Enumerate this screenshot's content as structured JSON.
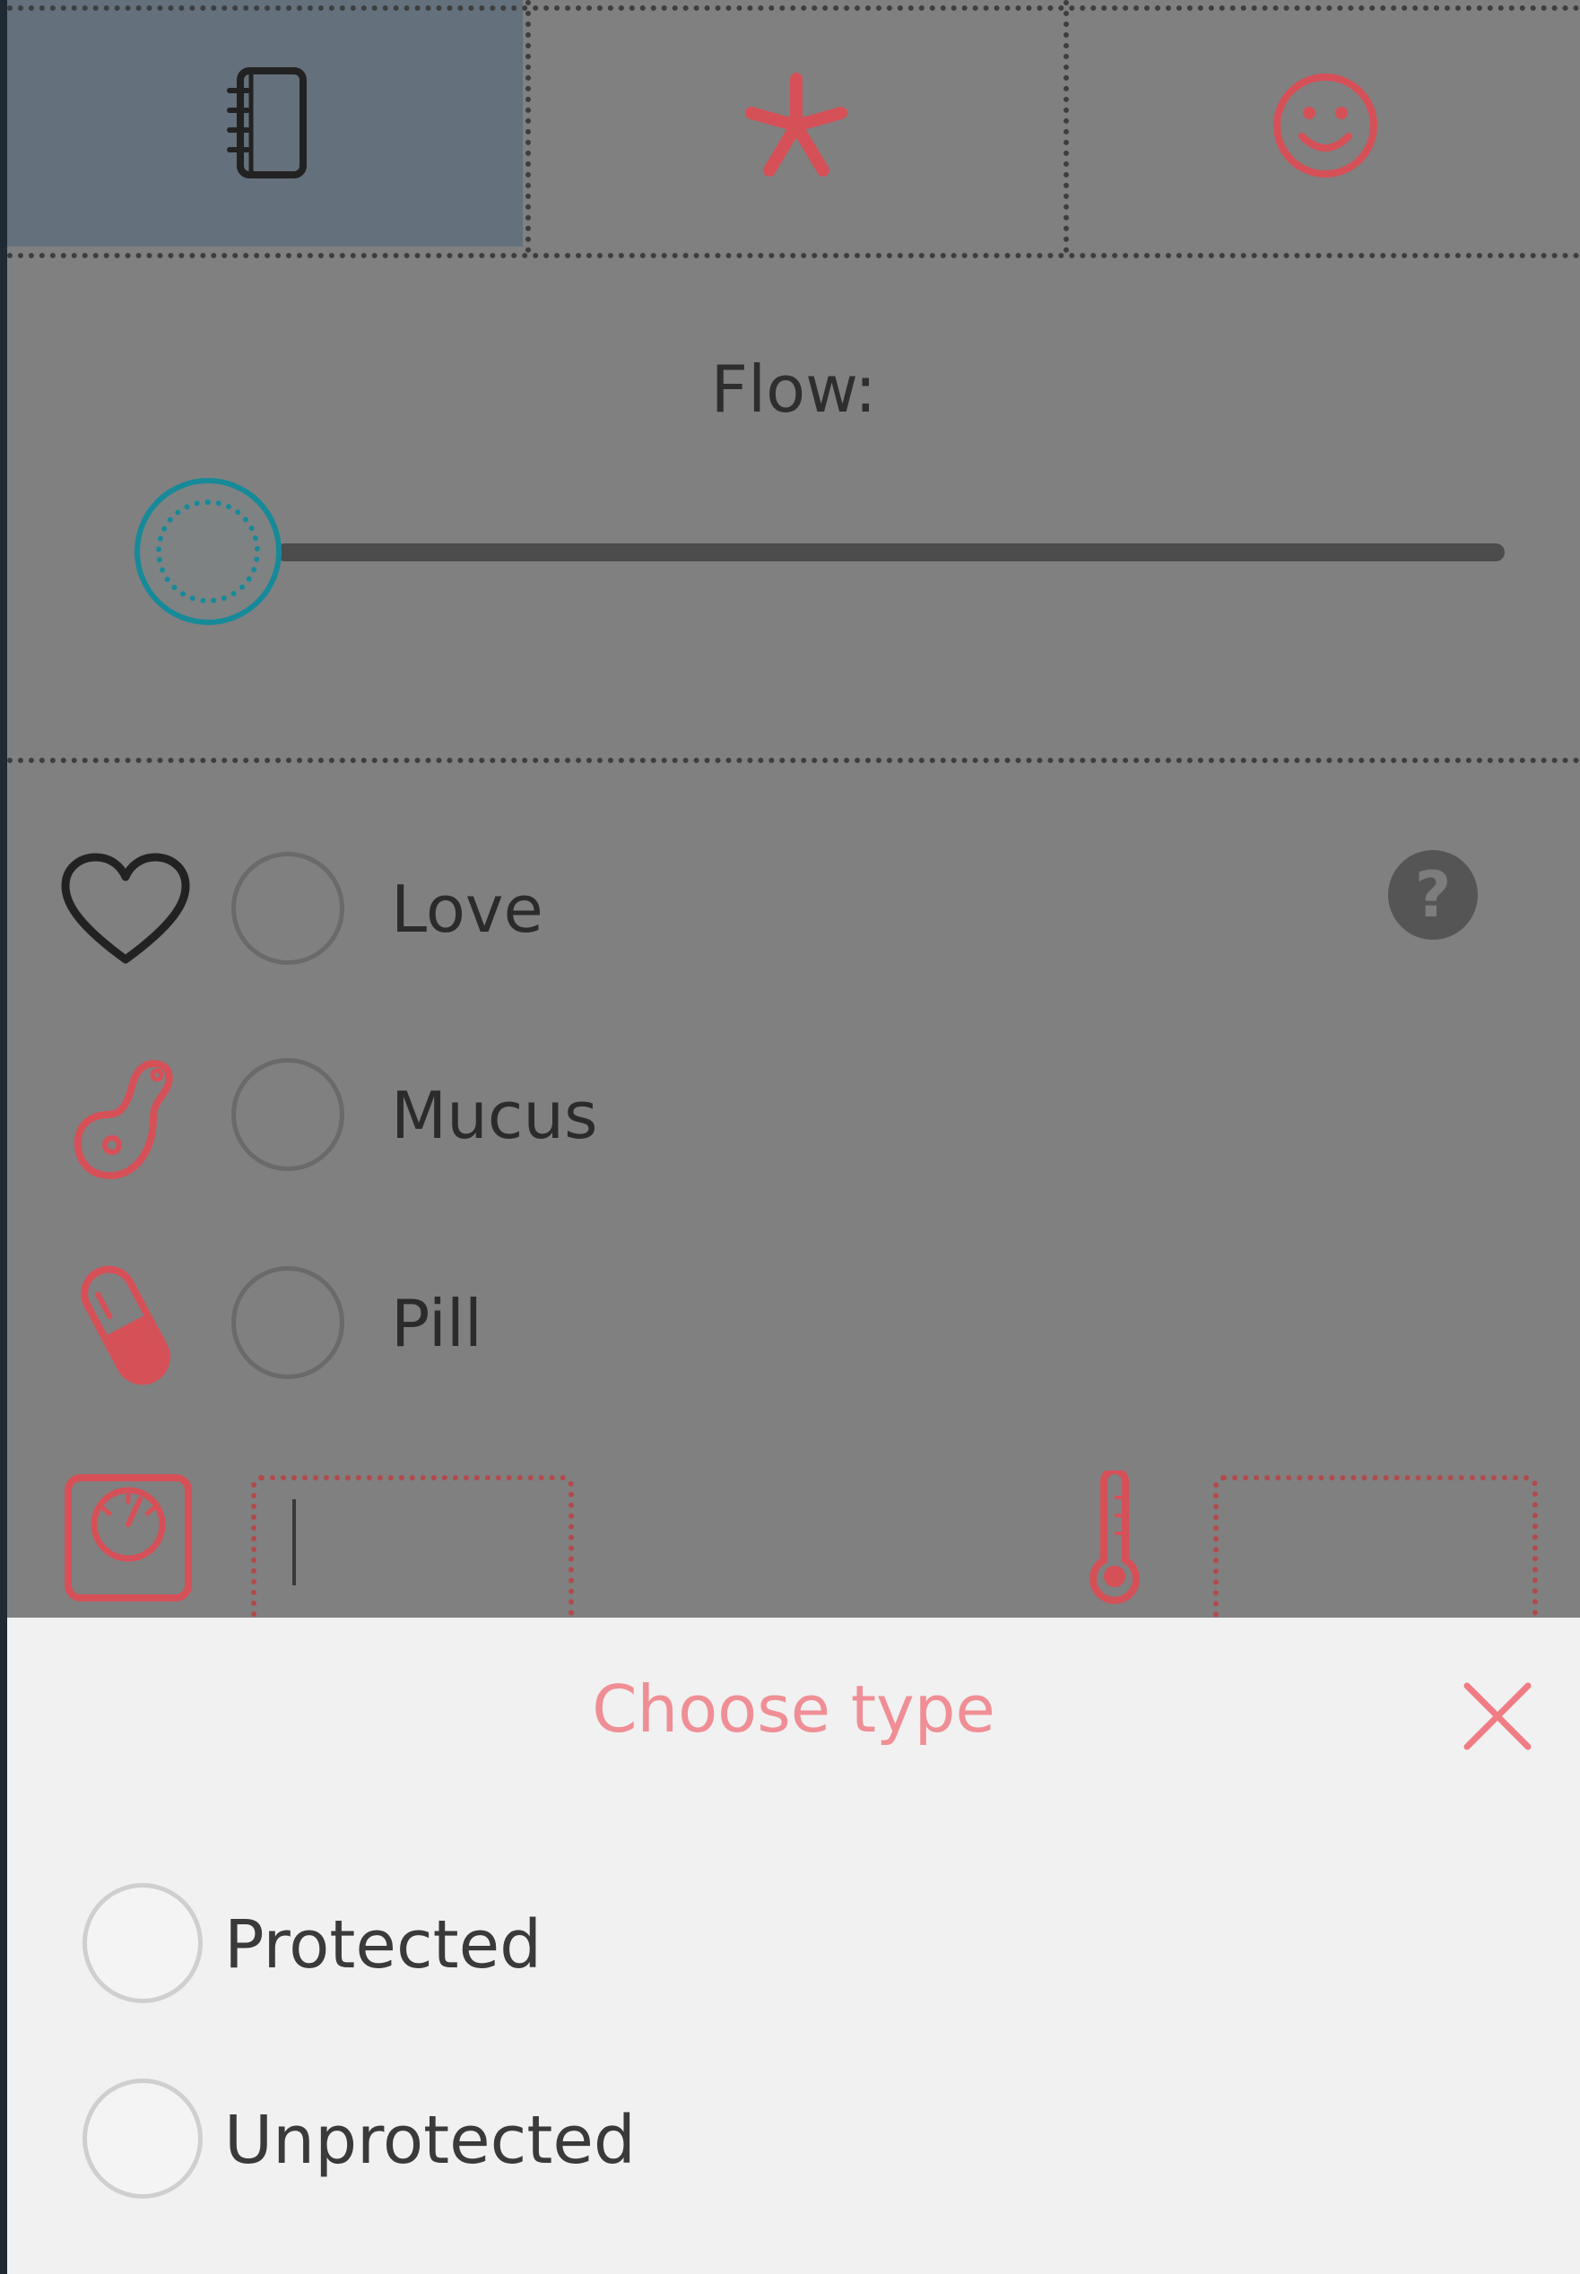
{
  "tabs": [
    {
      "icon": "notebook-icon",
      "selected": true
    },
    {
      "icon": "asterisk-icon",
      "selected": false
    },
    {
      "icon": "smiley-icon",
      "selected": false
    }
  ],
  "flow": {
    "label": "Flow:",
    "value": 0
  },
  "rows": [
    {
      "icon": "heart-icon",
      "label": "Love"
    },
    {
      "icon": "mucus-icon",
      "label": "Mucus"
    },
    {
      "icon": "pill-icon",
      "label": "Pill"
    }
  ],
  "help": {
    "label": "?"
  },
  "measurements": {
    "weight_icon": "scale-icon",
    "temperature_icon": "thermometer-icon",
    "weight_value": "",
    "temperature_value": ""
  },
  "sheet": {
    "title": "Choose type",
    "options": [
      "Protected",
      "Unprotected"
    ]
  },
  "colors": {
    "accent_pink": "#e0585f",
    "teal": "#168a98",
    "selected_tab": "#64707b",
    "sheet_bg": "#f1f1f1",
    "overlay": "#808080"
  }
}
